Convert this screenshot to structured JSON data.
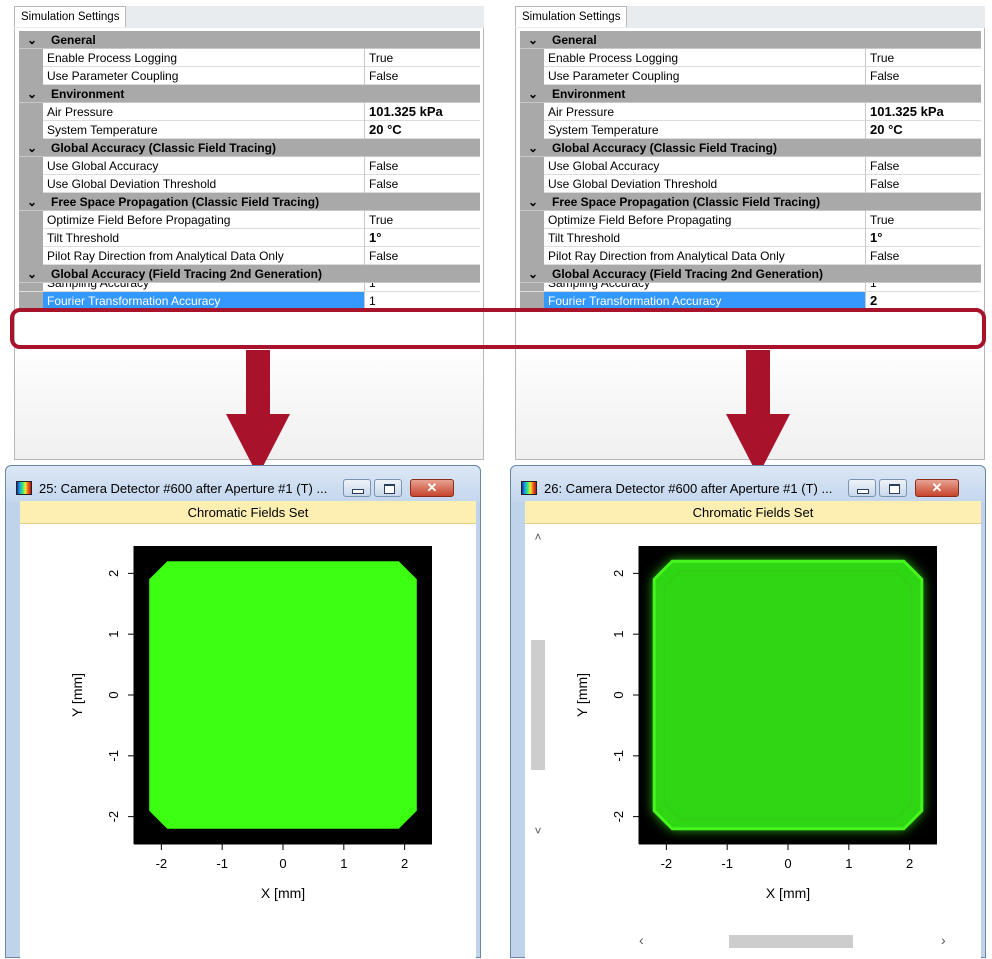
{
  "colors": {
    "highlight": "#a8122a",
    "category_bg": "#a9a9a9",
    "selection": "#3399ff",
    "field_left": "#3cff11",
    "field_right": "#2ed614",
    "ribbon": "#fdeeb2"
  },
  "left_panel": {
    "tab": "Simulation Settings",
    "categories": [
      {
        "label": "General",
        "props": [
          {
            "name": "Enable Process Logging",
            "value": "True"
          },
          {
            "name": "Use Parameter Coupling",
            "value": "False"
          }
        ]
      },
      {
        "label": "Environment",
        "props": [
          {
            "name": "Air Pressure",
            "value": "101.325 kPa"
          },
          {
            "name": "System Temperature",
            "value": "20 °C"
          }
        ]
      },
      {
        "label": "Global Accuracy (Classic Field Tracing)",
        "props": [
          {
            "name": "Use Global Accuracy",
            "value": "False"
          },
          {
            "name": "Use Global Deviation Threshold",
            "value": "False"
          }
        ]
      },
      {
        "label": "Free Space Propagation (Classic Field Tracing)",
        "props": [
          {
            "name": "Optimize Field Before Propagating",
            "value": "True"
          },
          {
            "name": "Tilt Threshold",
            "value": "1°"
          },
          {
            "name": "Pilot Ray Direction from Analytical Data Only",
            "value": "False"
          }
        ]
      },
      {
        "label": "Global Accuracy (Field Tracing 2nd Generation)",
        "props": [
          {
            "name": "Sampling Accuracy",
            "value": "1"
          },
          {
            "name": "Fourier Transformation Accuracy",
            "value": "1"
          }
        ]
      }
    ]
  },
  "right_panel": {
    "tab": "Simulation Settings",
    "categories": [
      {
        "label": "General",
        "props": [
          {
            "name": "Enable Process Logging",
            "value": "True"
          },
          {
            "name": "Use Parameter Coupling",
            "value": "False"
          }
        ]
      },
      {
        "label": "Environment",
        "props": [
          {
            "name": "Air Pressure",
            "value": "101.325 kPa"
          },
          {
            "name": "System Temperature",
            "value": "20 °C"
          }
        ]
      },
      {
        "label": "Global Accuracy (Classic Field Tracing)",
        "props": [
          {
            "name": "Use Global Accuracy",
            "value": "False"
          },
          {
            "name": "Use Global Deviation Threshold",
            "value": "False"
          }
        ]
      },
      {
        "label": "Free Space Propagation (Classic Field Tracing)",
        "props": [
          {
            "name": "Optimize Field Before Propagating",
            "value": "True"
          },
          {
            "name": "Tilt Threshold",
            "value": "1°"
          },
          {
            "name": "Pilot Ray Direction from Analytical Data Only",
            "value": "False"
          }
        ]
      },
      {
        "label": "Global Accuracy (Field Tracing 2nd Generation)",
        "props": [
          {
            "name": "Sampling Accuracy",
            "value": "1"
          },
          {
            "name": "Fourier Transformation Accuracy",
            "value": "2"
          }
        ]
      }
    ]
  },
  "left_window": {
    "title": "25: Camera Detector #600 after Aperture #1 (T) ...",
    "ribbon": "Chromatic Fields Set",
    "buttons": {
      "minimize": "",
      "maximize": "",
      "close": "✕"
    }
  },
  "right_window": {
    "title": "26: Camera Detector #600 after Aperture #1 (T) ...",
    "ribbon": "Chromatic Fields Set",
    "buttons": {
      "minimize": "",
      "maximize": "",
      "close": "✕"
    },
    "scroll": {
      "up": "˄",
      "down": "˅",
      "left": "‹",
      "right": "›"
    }
  },
  "chart_data": [
    {
      "type": "heatmap",
      "xlabel": "X [mm]",
      "ylabel": "Y [mm]",
      "xlim": [
        -2.45,
        2.45
      ],
      "ylim": [
        -2.45,
        2.45
      ],
      "xticks": [
        "-2",
        "-1",
        "0",
        "1",
        "2"
      ],
      "yticks": [
        "2",
        "1",
        "0",
        "-1",
        "-2"
      ],
      "field": {
        "shape": "rounded square",
        "extent": [
          -2.2,
          2.2
        ],
        "edge": "sharp"
      }
    },
    {
      "type": "heatmap",
      "xlabel": "X [mm]",
      "ylabel": "Y [mm]",
      "xlim": [
        -2.45,
        2.45
      ],
      "ylim": [
        -2.45,
        2.45
      ],
      "xticks": [
        "-2",
        "-1",
        "0",
        "1",
        "2"
      ],
      "yticks": [
        "2",
        "1",
        "0",
        "-1",
        "-2"
      ],
      "field": {
        "shape": "rounded square",
        "extent": [
          -2.2,
          2.2
        ],
        "edge": "soft"
      }
    }
  ]
}
